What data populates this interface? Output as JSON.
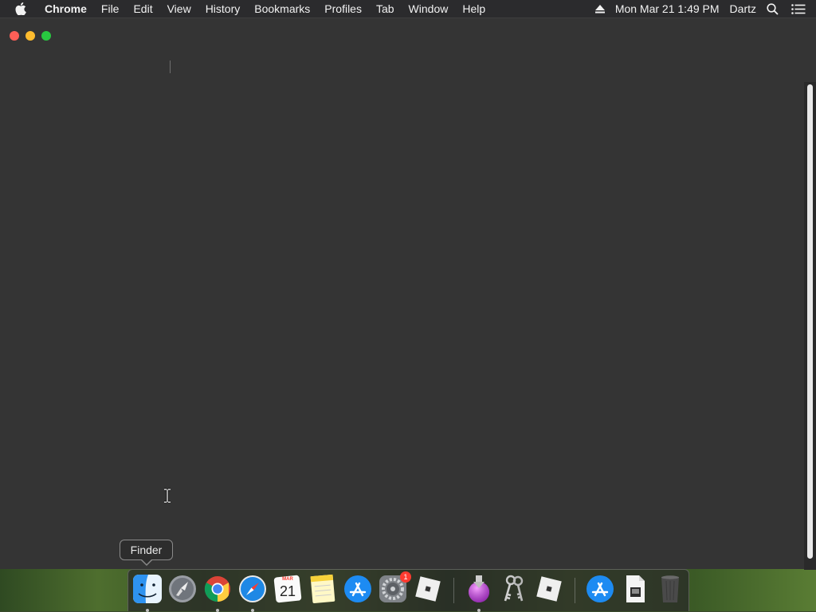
{
  "menubar": {
    "app_name": "Chrome",
    "items": [
      "File",
      "Edit",
      "View",
      "History",
      "Bookmarks",
      "Profiles",
      "Tab",
      "Window",
      "Help"
    ],
    "clock": "Mon Mar 21  1:49 PM",
    "user": "Dartz"
  },
  "window": {
    "traffic_lights": [
      "close",
      "minimize",
      "maximize"
    ]
  },
  "tooltip": {
    "text": "Finder"
  },
  "dock": {
    "items": [
      {
        "name": "Finder",
        "icon": "finder-icon",
        "running": true
      },
      {
        "name": "Launchpad",
        "icon": "launchpad-icon",
        "running": false
      },
      {
        "name": "Google Chrome",
        "icon": "chrome-icon",
        "running": true
      },
      {
        "name": "Safari",
        "icon": "safari-icon",
        "running": true
      },
      {
        "name": "Calendar",
        "icon": "calendar-icon",
        "running": false,
        "month": "MAR",
        "day": "21"
      },
      {
        "name": "Notes",
        "icon": "notes-icon",
        "running": false
      },
      {
        "name": "App Store",
        "icon": "app-store-icon",
        "running": false
      },
      {
        "name": "System Preferences",
        "icon": "system-preferences-icon",
        "running": false,
        "badge": "1"
      },
      {
        "name": "Roblox",
        "icon": "roblox-icon",
        "running": false
      },
      {
        "name": "Installer",
        "icon": "installer-icon",
        "running": true
      },
      {
        "name": "Keychain Access",
        "icon": "keychain-icon",
        "running": false
      },
      {
        "name": "Roblox Studio",
        "icon": "roblox-studio-icon",
        "running": false
      },
      {
        "name": "App Store Downloads",
        "icon": "downloads-app-store-icon",
        "running": false
      },
      {
        "name": "Document",
        "icon": "document-icon",
        "running": false
      },
      {
        "name": "Trash",
        "icon": "trash-icon",
        "running": false
      }
    ]
  },
  "colors": {
    "menubar_bg": "#2b2b2d",
    "window_bg": "#343434",
    "close": "#fe5f57",
    "minimize": "#febc2e",
    "maximize": "#28c840"
  }
}
